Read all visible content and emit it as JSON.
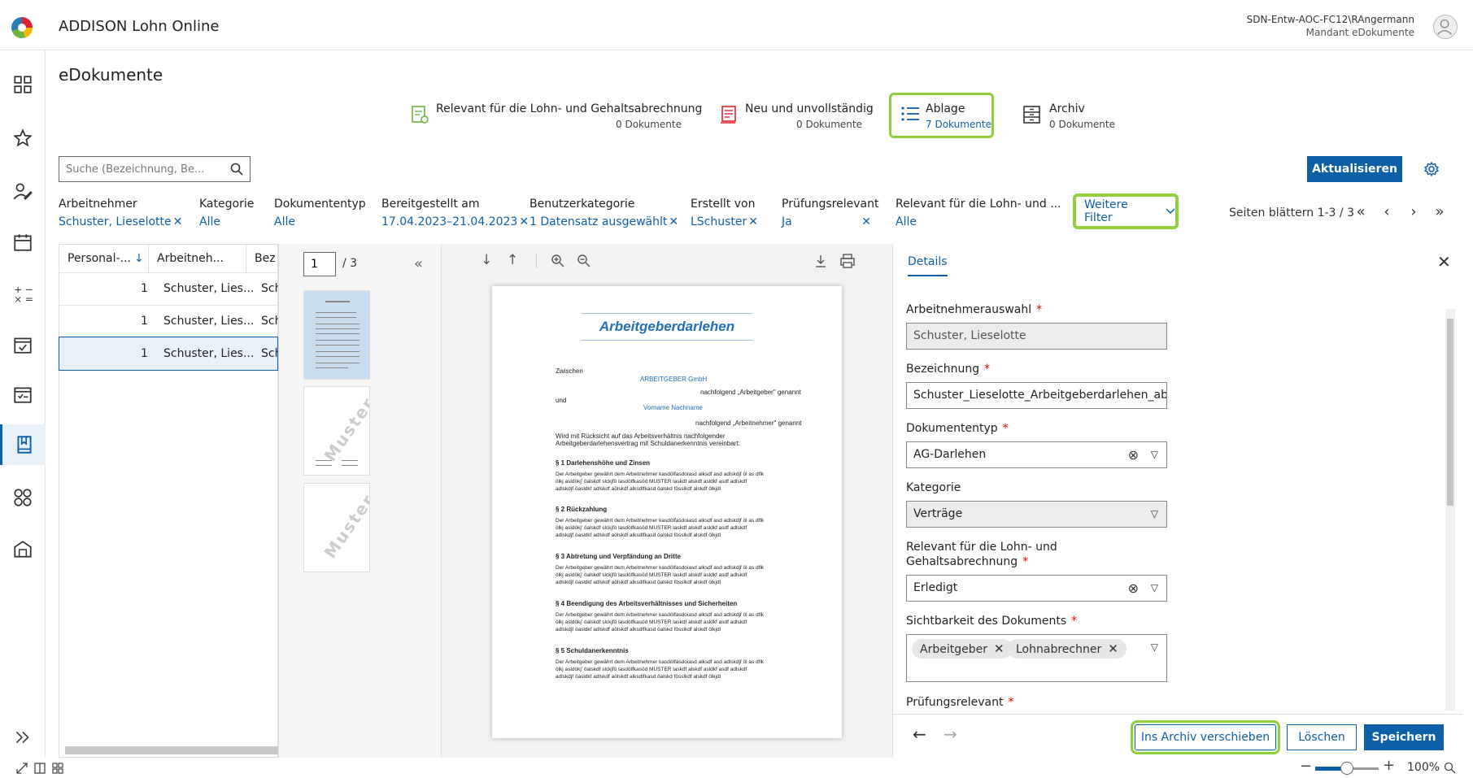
{
  "app": {
    "title": "ADDISON Lohn Online",
    "user_name": "SDN-Entw-AOC-FC12\\RAngermann",
    "user_sub": "Mandant eDokumente"
  },
  "page": {
    "title": "eDokumente"
  },
  "categories": [
    {
      "label": "Relevant für die Lohn- und Gehaltsabrechnung",
      "count": "0 Dokumente"
    },
    {
      "label": "Neu und unvollständig",
      "count": "0 Dokumente"
    },
    {
      "label": "Ablage",
      "count": "7 Dokumente"
    },
    {
      "label": "Archiv",
      "count": "0 Dokumente"
    }
  ],
  "search": {
    "placeholder": "Suche (Bezeichnung, Be..."
  },
  "toolbar": {
    "refresh_label": "Aktualisieren"
  },
  "filters": [
    {
      "label": "Arbeitnehmer",
      "value": "Schuster, Lieselotte",
      "clearable": true
    },
    {
      "label": "Kategorie",
      "value": "Alle"
    },
    {
      "label": "Dokumententyp",
      "value": "Alle"
    },
    {
      "label": "Bereitgestellt am",
      "value": "17.04.2023–21.04.2023",
      "clearable": true
    },
    {
      "label": "Benutzerkategorie",
      "value": "1 Datensatz ausgewählt",
      "clearable": true
    },
    {
      "label": "Erstellt von",
      "value": "LSchuster",
      "clearable": true
    },
    {
      "label": "Prüfungsrelevant",
      "value": "Ja",
      "clearable": true
    },
    {
      "label": "Relevant für die Lohn- und ...",
      "value": "Alle"
    }
  ],
  "more_filters_label": "Weitere Filter",
  "paging": {
    "label": "Seiten blättern 1-3 / 3"
  },
  "table": {
    "columns": [
      "Personal-...",
      "Arbeitneh...",
      "Bez"
    ],
    "rows": [
      {
        "num": "1",
        "name": "Schuster, Lies...",
        "bez": "Sch"
      },
      {
        "num": "1",
        "name": "Schuster, Lies...",
        "bez": "Sch"
      },
      {
        "num": "1",
        "name": "Schuster, Lies...",
        "bez": "Sch"
      }
    ]
  },
  "viewer": {
    "current_page": "1",
    "total_pages": "/ 3",
    "watermark": "Muster",
    "doc": {
      "title": "Arbeitgeberdarlehen",
      "zwischen": "Zwischen",
      "employer": "ARBEITGEBER GmbH",
      "employer_note": "nachfolgend „Arbeitgeber\" genannt",
      "und": "und",
      "employee": "Vorname Nachname",
      "employee_note": "nachfolgend „Arbeitnehmer\" genannt",
      "intro_1": "Wird mit Rücksicht auf das Arbeitsverhältnis nachfolgender",
      "intro_2": "Arbeitgeberdarlehensvertrag mit Schuldanerkenntnis vereinbart:",
      "sections": [
        "§ 1 Darlehenshöhe und Zinsen",
        "§ 2 Rückzahlung",
        "§ 3 Abtretung und Verpfändung an Dritte",
        "§ 4 Beendigung des Arbeitsverhältnisses und Sicherheiten",
        "§ 5 Schuldanerkenntnis"
      ],
      "body_lines": [
        "Der Arbeitgeber gewährt dem Arbeitnehmer kasdölfasdoiasd alksdf asd adlskdjf öl as dflk",
        "ölkj asldökj' öalskdf slckjfö lasdölfkasöd MUSTER laskdf alskdf asldkf asdf adlskdf",
        "adlskdjf öasldkf adlskdf aölskdf alksdlfkasd öalskd fösslkdf alskdf ölkjdl"
      ]
    }
  },
  "details": {
    "tab_label": "Details",
    "fields": {
      "arbeitnehmer": {
        "label": "Arbeitnehmerauswahl",
        "value": "Schuster, Lieselotte"
      },
      "bezeichnung": {
        "label": "Bezeichnung",
        "value": "Schuster_Lieselotte_Arbeitgeberdarlehen_ab..."
      },
      "dokumententyp": {
        "label": "Dokumententyp",
        "value": "AG-Darlehen"
      },
      "kategorie": {
        "label": "Kategorie",
        "value": "Verträge"
      },
      "relevant": {
        "label_1": "Relevant für die Lohn- und",
        "label_2": "Gehaltsabrechnung",
        "value": "Erledigt"
      },
      "sichtbarkeit": {
        "label": "Sichtbarkeit des Dokuments",
        "chips": [
          "Arbeitgeber",
          "Lohnabrechner"
        ]
      },
      "pruefung": {
        "label": "Prüfungsrelevant"
      }
    },
    "required_marker": "*",
    "buttons": {
      "archive": "Ins Archiv verschieben",
      "delete": "Löschen",
      "save": "Speichern"
    }
  },
  "statusbar": {
    "zoom": "100%",
    "zoom_fraction": 0.5
  },
  "colors": {
    "accent": "#0d5fa8",
    "highlight": "#8fce3e",
    "required": "#e00000"
  }
}
